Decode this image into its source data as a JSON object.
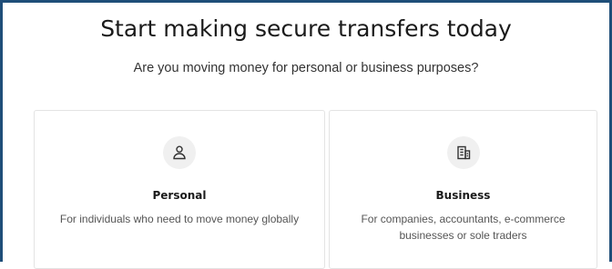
{
  "heading": {
    "title": "Start making secure transfers today",
    "subtitle": "Are you moving money for personal or business purposes?"
  },
  "options": [
    {
      "label": "Personal",
      "description": "For individuals who need to move money globally",
      "icon": "person-icon"
    },
    {
      "label": "Business",
      "description": "For companies, accountants, e-commerce businesses or sole traders",
      "icon": "building-icon"
    }
  ],
  "colors": {
    "frame_border": "#1f4e79",
    "icon_bg": "#f0f0f0",
    "text_dark": "#1b1b1b",
    "text_muted": "#555555"
  }
}
